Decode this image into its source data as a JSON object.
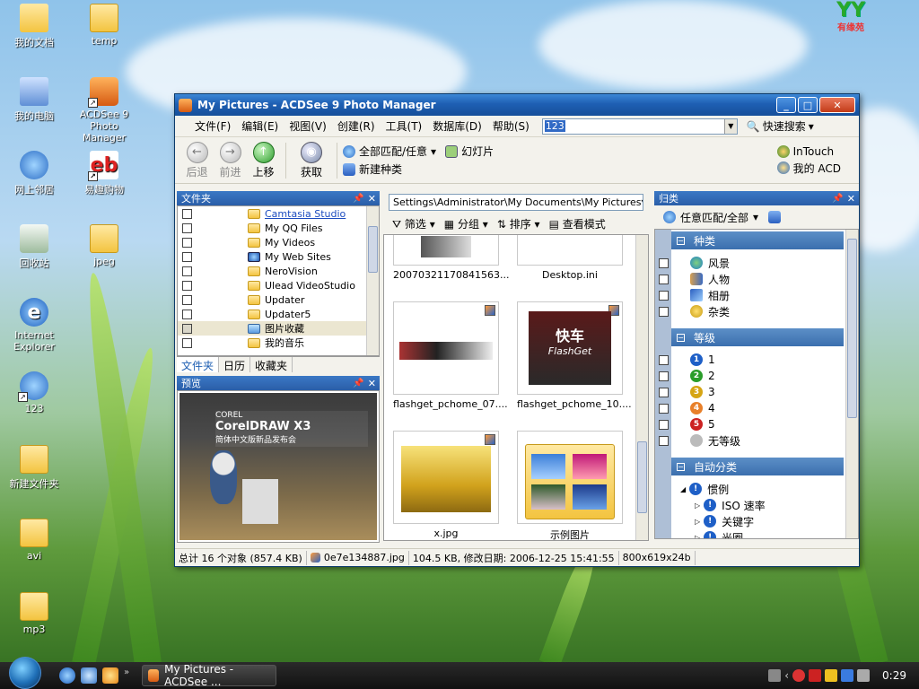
{
  "desktop": {
    "logo": {
      "text": "YY",
      "sub": "有缘苑"
    },
    "icons": [
      {
        "label": "我的文档",
        "icon": "documents-folder-icon"
      },
      {
        "label": "temp",
        "icon": "folder-icon"
      },
      {
        "label": "我的电脑",
        "icon": "computer-icon"
      },
      {
        "label": "ACDSee 9 Photo Manager",
        "icon": "acdsee-icon"
      },
      {
        "label": "网上邻居",
        "icon": "network-icon"
      },
      {
        "label": "易趣购物",
        "icon": "ebay-icon"
      },
      {
        "label": "回收站",
        "icon": "recycle-bin-icon"
      },
      {
        "label": "jpeg",
        "icon": "folder-icon"
      },
      {
        "label": "Internet Explorer",
        "icon": "internet-explorer-icon"
      },
      {
        "label": "123",
        "icon": "network-folder-icon"
      },
      {
        "label": "新建文件夹",
        "icon": "folder-icon"
      },
      {
        "label": "avi",
        "icon": "folder-icon"
      },
      {
        "label": "mp3",
        "icon": "folder-icon"
      }
    ]
  },
  "window": {
    "title": "My Pictures - ACDSee 9 Photo Manager",
    "menu": [
      "文件(F)",
      "编辑(E)",
      "视图(V)",
      "创建(R)",
      "工具(T)",
      "数据库(D)",
      "帮助(S)"
    ],
    "search": {
      "value": "123",
      "quick_search": "快速搜索"
    },
    "toolbar": {
      "back": "后退",
      "forward": "前进",
      "up": "上移",
      "acquire": "获取",
      "match_all": "全部匹配/任意",
      "slideshow": "幻灯片",
      "new_category": "新建种类",
      "intouch": "InTouch",
      "my_acd": "我的 ACD"
    },
    "folders_pane": {
      "title": "文件夹",
      "items": [
        {
          "label": "Camtasia Studio",
          "link": true
        },
        {
          "label": "My QQ Files"
        },
        {
          "label": "My Videos"
        },
        {
          "label": "My Web Sites"
        },
        {
          "label": "NeroVision"
        },
        {
          "label": "Ulead VideoStudio"
        },
        {
          "label": "Updater"
        },
        {
          "label": "Updater5"
        },
        {
          "label": "图片收藏",
          "highlight": true
        },
        {
          "label": "我的音乐"
        }
      ],
      "tabs": [
        "文件夹",
        "日历",
        "收藏夹"
      ]
    },
    "preview_pane": {
      "title": "预览",
      "image_text": "CorelDRAW X3",
      "image_subtext": "简体中文版新品发布会",
      "image_brand": "COREL"
    },
    "browser": {
      "path": "Settings\\Administrator\\My Documents\\My Pictures",
      "filter": "筛选",
      "group": "分组",
      "sort": "排序",
      "view_mode": "查看模式",
      "thumbnails": [
        {
          "name": "20070321170841563..."
        },
        {
          "name": "Desktop.ini"
        },
        {
          "name": "flashget_pchome_07...."
        },
        {
          "name": "flashget_pchome_10...."
        },
        {
          "name": "x.jpg"
        },
        {
          "name": "示例图片"
        }
      ],
      "flashget_text": "快车",
      "flashget_sub": "FlashGet"
    },
    "organize_pane": {
      "title": "归类",
      "match": "任意匹配/全部",
      "sections": [
        {
          "title": "种类",
          "items": [
            {
              "label": "风景",
              "icon": "globe-icon"
            },
            {
              "label": "人物",
              "icon": "people-icon"
            },
            {
              "label": "相册",
              "icon": "album-icon"
            },
            {
              "label": "杂类",
              "icon": "misc-icon"
            }
          ]
        },
        {
          "title": "等级",
          "items": [
            {
              "label": "1",
              "color": "#1e5fc7"
            },
            {
              "label": "2",
              "color": "#2a9d2a"
            },
            {
              "label": "3",
              "color": "#d6a514"
            },
            {
              "label": "4",
              "color": "#e8802a"
            },
            {
              "label": "5",
              "color": "#cc2222"
            },
            {
              "label": "无等级",
              "color": "#bbbbbb"
            }
          ]
        },
        {
          "title": "自动分类",
          "items": [
            {
              "label": "惯例"
            },
            {
              "label": "ISO 速率"
            },
            {
              "label": "关键字"
            },
            {
              "label": "光圈"
            }
          ]
        }
      ]
    },
    "status": {
      "total": "总计 16 个对象 (857.4 KB)",
      "file": "0e7e134887.jpg",
      "info": "104.5 KB, 修改日期: 2006-12-25 15:41:55",
      "dims": "800x619x24b"
    }
  },
  "taskbar": {
    "task_label": "My Pictures - ACDSee ...",
    "clock": "0:29"
  }
}
